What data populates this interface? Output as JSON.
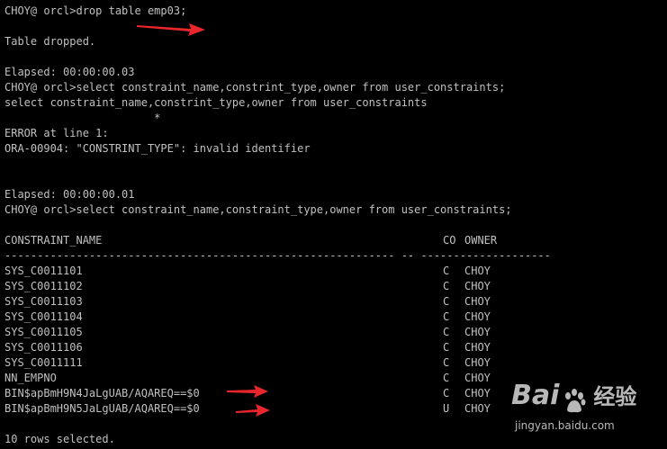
{
  "colors": {
    "background": "#000000",
    "text": "#c0c0c0",
    "arrow": "#e8262c",
    "watermark": "#ffffff"
  },
  "console": {
    "lines": [
      "CHOY@ orcl>drop table emp03;",
      "",
      "Table dropped.",
      "",
      "Elapsed: 00:00:00.03",
      "CHOY@ orcl>select constraint_name,constrint_type,owner from user_constraints;",
      "select constraint_name,constrint_type,owner from user_constraints",
      "                       *",
      "ERROR at line 1:",
      "ORA-00904: \"CONSTRINT_TYPE\": invalid identifier",
      "",
      "",
      "Elapsed: 00:00:00.01",
      "CHOY@ orcl>select constraint_name,constraint_type,owner from user_constraints;",
      "",
      "",
      "------------------------------------------------------------ -- --------------------"
    ]
  },
  "result": {
    "headers": [
      "CONSTRAINT_NAME",
      "CO",
      "OWNER"
    ],
    "rows": [
      [
        "SYS_C0011101",
        "C",
        "CHOY"
      ],
      [
        "SYS_C0011102",
        "C",
        "CHOY"
      ],
      [
        "SYS_C0011103",
        "C",
        "CHOY"
      ],
      [
        "SYS_C0011104",
        "C",
        "CHOY"
      ],
      [
        "SYS_C0011105",
        "C",
        "CHOY"
      ],
      [
        "SYS_C0011106",
        "C",
        "CHOY"
      ],
      [
        "SYS_C0011111",
        "C",
        "CHOY"
      ],
      [
        "NN_EMPNO",
        "C",
        "CHOY"
      ],
      [
        "BIN$apBmH9N4JaLgUAB/AQAREQ==$0",
        "C",
        "CHOY"
      ],
      [
        "BIN$apBmH9N5JaLgUAB/AQAREQ==$0",
        "U",
        "CHOY"
      ]
    ],
    "footer": [
      "",
      "10 rows selected."
    ]
  },
  "watermark": {
    "logo_part1": "Bai",
    "logo_part2": "经验",
    "url": "jingyan.baidu.com"
  }
}
